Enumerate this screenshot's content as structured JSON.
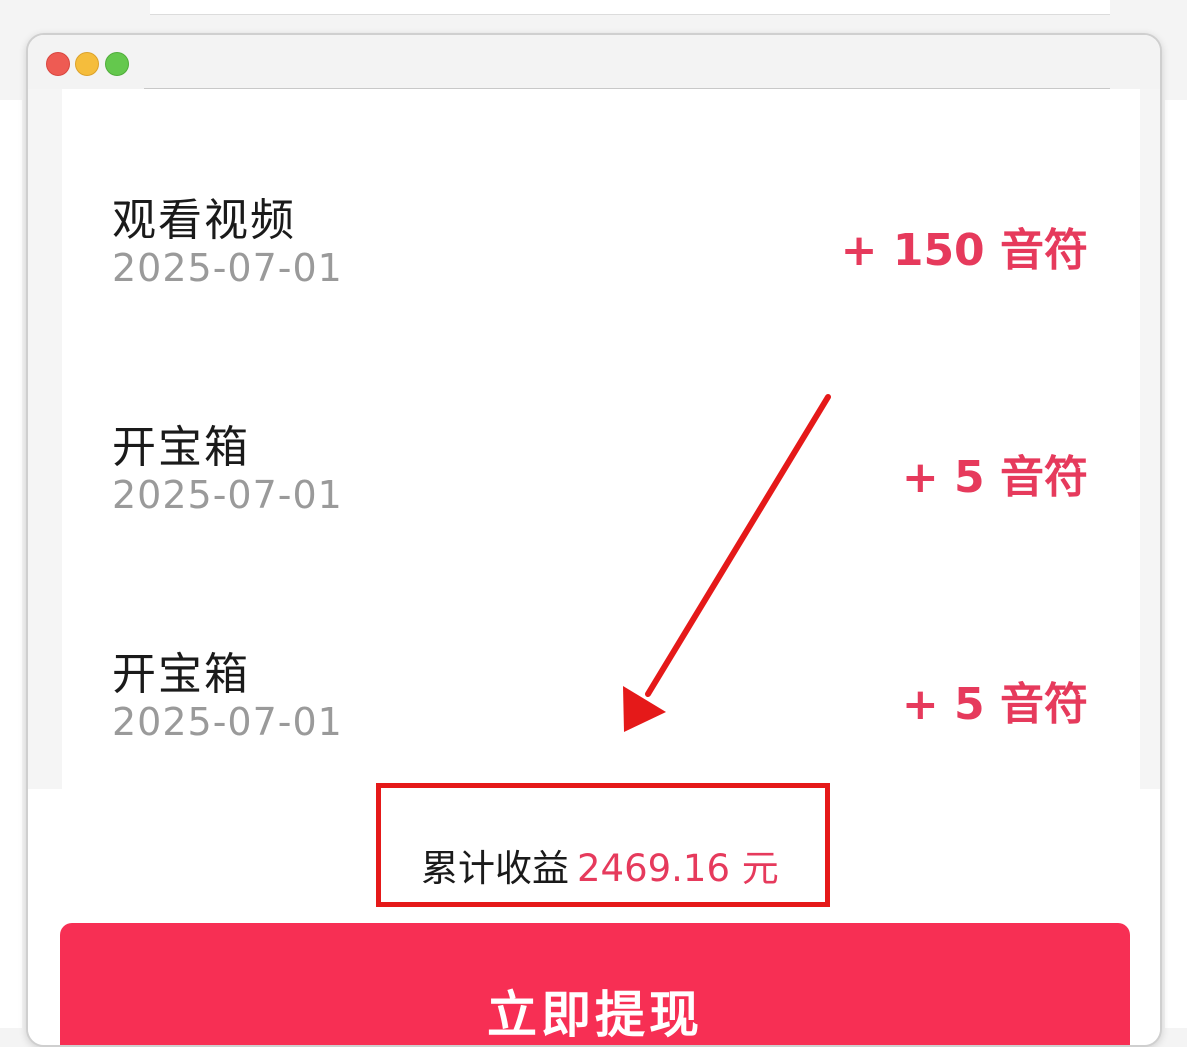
{
  "records": [
    {
      "title": "观看视频",
      "date": "2025-07-01",
      "amount": "+ 150 音符"
    },
    {
      "title": "开宝箱",
      "date": "2025-07-01",
      "amount": "+ 5 音符"
    },
    {
      "title": "开宝箱",
      "date": "2025-07-01",
      "amount": "+ 5 音符"
    }
  ],
  "earnings": {
    "label": "累计收益",
    "value": "2469.16 元"
  },
  "withdraw_button": {
    "label": "立即提现"
  },
  "colors": {
    "accent": "#e63a5c",
    "button": "#f72f54",
    "annotation": "#e51919"
  }
}
